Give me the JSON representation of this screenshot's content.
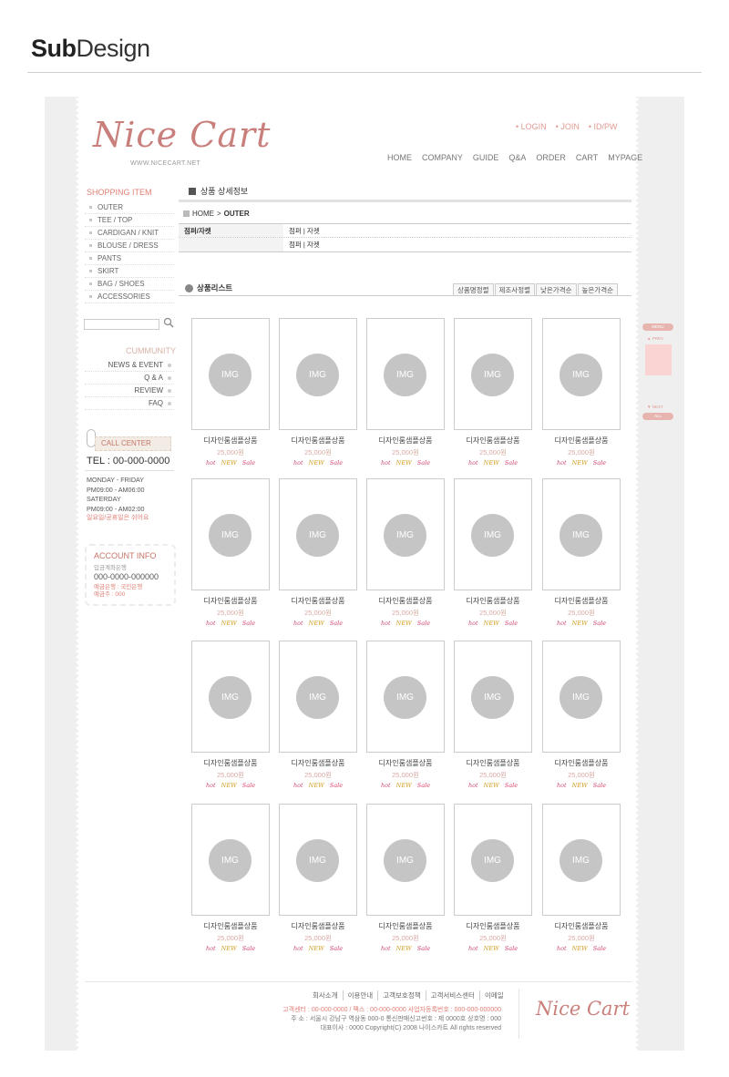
{
  "banner": {
    "title_bold": "Sub",
    "title_rest": "Design"
  },
  "header": {
    "logo": "Nice Cart",
    "url": "WWW.NICECART.NET",
    "toplinks": [
      "LOGIN",
      "JOIN",
      "ID/PW"
    ],
    "nav": [
      "HOME",
      "COMPANY",
      "GUIDE",
      "Q&A",
      "ORDER",
      "CART",
      "MYPAGE"
    ]
  },
  "sidebar": {
    "shopping_title": "SHOPPING ITEM",
    "items": [
      "OUTER",
      "TEE / TOP",
      "CARDIGAN / KNIT",
      "BLOUSE / DRESS",
      "PANTS",
      "SKIRT",
      "BAG / SHOES",
      "ACCESSORIES"
    ],
    "community_title": "CUMMUNITY",
    "community": [
      "NEWS & EVENT",
      "Q & A",
      "REVIEW",
      "FAQ"
    ],
    "call_center": "CALL CENTER",
    "tel": "TEL : 00-000-0000",
    "hours": [
      "MONDAY - FRIDAY",
      "PM09:00 - AM06:00",
      "SATERDAY",
      "PM09:00 - AM02:00"
    ],
    "holiday": "일요일/공휴일은 쉬어요",
    "account_title": "ACCOUNT INFO",
    "account_bank": "입금계좌은행",
    "account_no": "000-0000-000000",
    "account_sub1": "예금은행 : 국민은행",
    "account_sub2": "예금주 : 000"
  },
  "main": {
    "detail_title": "상품 상세정보",
    "breadcrumb_home": "HOME",
    "breadcrumb_current": "OUTER",
    "category_rows": [
      {
        "key": "점퍼/자켓",
        "value": "점퍼 | 자켓"
      },
      {
        "key": "",
        "value": "점퍼 | 자켓"
      }
    ],
    "list_title": "상품리스트",
    "sort_tabs": [
      "상품명정렬",
      "제조사정렬",
      "낮은가격순",
      "높은가격순"
    ],
    "product": {
      "img": "IMG",
      "name": "디자인룸샘플상품",
      "price": "25,000원",
      "badges": [
        "hot",
        "NEW",
        "Sale"
      ]
    }
  },
  "quickbar": {
    "menu": "MENU",
    "prev": "▲ PREV",
    "next": "▼ NEXT",
    "all": "ALL"
  },
  "footer": {
    "links": [
      "회사소개",
      "이용안내",
      "고객보호정책",
      "고객서비스센터",
      "이메일"
    ],
    "line1": "고객센터 : 00-000-0000 / 팩스 : 00-000-0000    사업자등록번호 : 000-000-000000",
    "line2": "주 소 : 서울시 강남구 역삼동 000-0    통신판매신고번호 : 제 0000호    상호명 : 000",
    "line3": "대표이사 : 0000 Copyright(C) 2008 나이스카트 All rights reserved",
    "logo": "Nice Cart"
  }
}
